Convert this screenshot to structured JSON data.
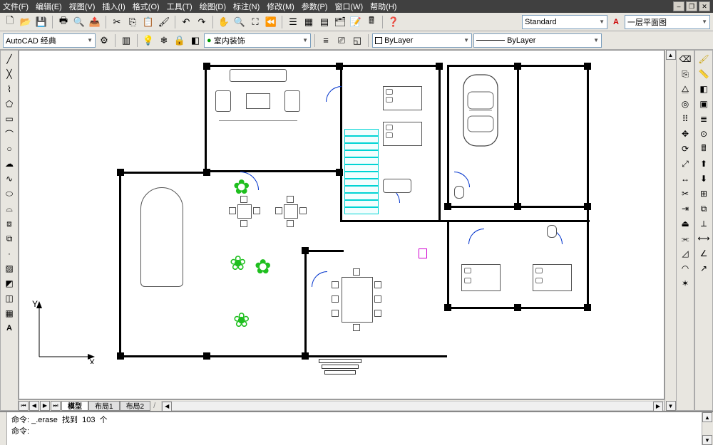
{
  "menu": {
    "items": [
      "文件(F)",
      "编辑(E)",
      "视图(V)",
      "插入(I)",
      "格式(O)",
      "工具(T)",
      "绘图(D)",
      "标注(N)",
      "修改(M)",
      "参数(P)",
      "窗口(W)",
      "帮助(H)"
    ]
  },
  "toolbar2": {
    "workspace": "AutoCAD 经典",
    "linetype_scale": "室内装饰",
    "layer": "ByLayer",
    "text_style": "Standard",
    "dim_style": "一层平面图",
    "lineweight": "ByLayer"
  },
  "tabs": {
    "model": "模型",
    "layout1": "布局1",
    "layout2": "布局2"
  },
  "command": {
    "label": "命令:",
    "last": "_.erase",
    "found": "找到",
    "count": "103",
    "unit": "个"
  },
  "ucs": {
    "x": "X",
    "y": "Y"
  }
}
